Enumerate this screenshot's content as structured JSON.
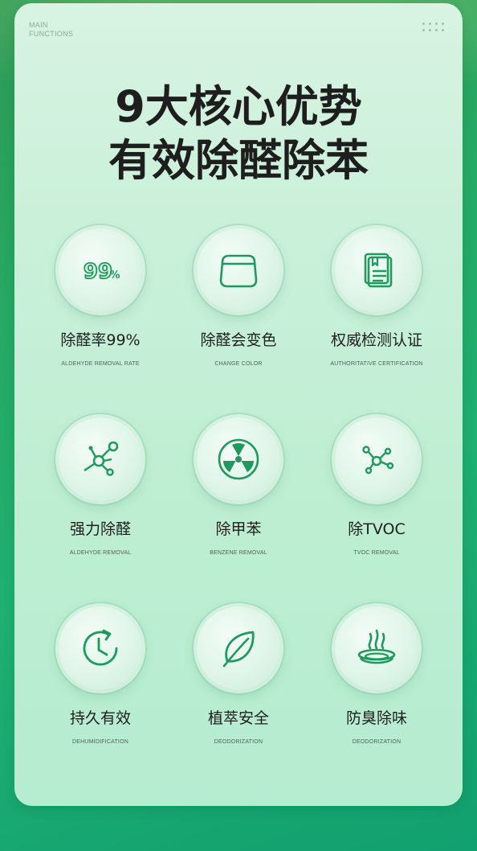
{
  "header": {
    "section_label_line1": "MAIN",
    "section_label_line2": "FUNCTIONS",
    "title_line1": "9大核心优势",
    "title_line2": "有效除醛除苯"
  },
  "features": [
    {
      "name": "除醛率99%",
      "en": "ALDEHYDE REMOVAL RATE",
      "icon": "percent-99-icon",
      "icon_text": "99",
      "icon_sub": "%"
    },
    {
      "name": "除醛会变色",
      "en": "CHANGE COLOR",
      "icon": "container-icon"
    },
    {
      "name": "权威检测认证",
      "en": "AUTHORITATIVE CERTIFICATION",
      "icon": "certificate-icon"
    },
    {
      "name": "强力除醛",
      "en": "ALDEHYDE REMOVAL",
      "icon": "molecule-icon"
    },
    {
      "name": "除甲苯",
      "en": "BENZENE REMOVAL",
      "icon": "radiation-icon"
    },
    {
      "name": "除TVOC",
      "en": "TVOC REMOVAL",
      "icon": "molecule-small-icon"
    },
    {
      "name": "持久有效",
      "en": "DEHUMIDIFICATION",
      "icon": "clock-refresh-icon"
    },
    {
      "name": "植萃安全",
      "en": "DEODORIZATION",
      "icon": "leaf-icon"
    },
    {
      "name": "防臭除味",
      "en": "DEODORIZATION",
      "icon": "steam-bowl-icon"
    }
  ],
  "colors": {
    "accent": "#1f9a5e",
    "card": "#c9f0d9",
    "title": "#1e1e1e"
  }
}
